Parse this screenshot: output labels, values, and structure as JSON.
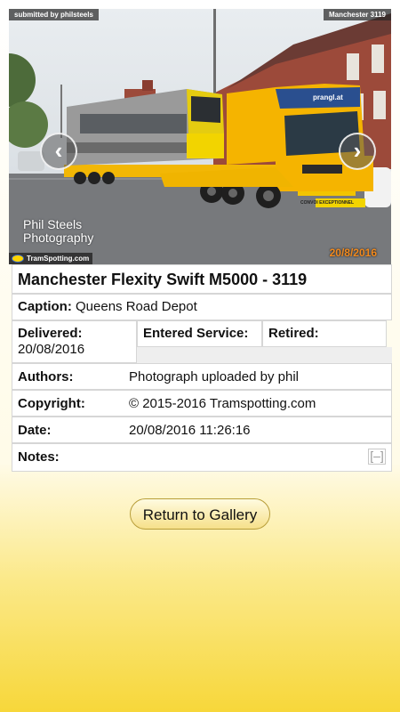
{
  "photo": {
    "submitted_by": "submitted by philsteels",
    "tram_ref": "Manchester 3119",
    "watermark_line1": "Phil Steels",
    "watermark_line2": "Photography",
    "site_logo": "TramSpotting.com",
    "datestamp": "20/8/2016",
    "prev_icon": "chevron-left-icon",
    "next_icon": "chevron-right-icon",
    "truck_sign": "prangl.at",
    "truck_plate": "CONVOI EXCEPTIONNEL"
  },
  "details": {
    "title": "Manchester Flexity Swift M5000 - 3119",
    "caption_label": "Caption:",
    "caption_value": "Queens Road Depot",
    "delivered_label": "Delivered:",
    "delivered_value": "20/08/2016",
    "entered_label": "Entered Service:",
    "retired_label": "Retired:",
    "authors_label": "Authors:",
    "authors_value": "Photograph uploaded by phil",
    "copyright_label": "Copyright:",
    "copyright_value": "© 2015-2016 Tramspotting.com",
    "date_label": "Date:",
    "date_value": "20/08/2016 11:26:16",
    "notes_label": "Notes:",
    "notes_toggle": "[–]"
  },
  "actions": {
    "return_label": "Return to Gallery"
  }
}
